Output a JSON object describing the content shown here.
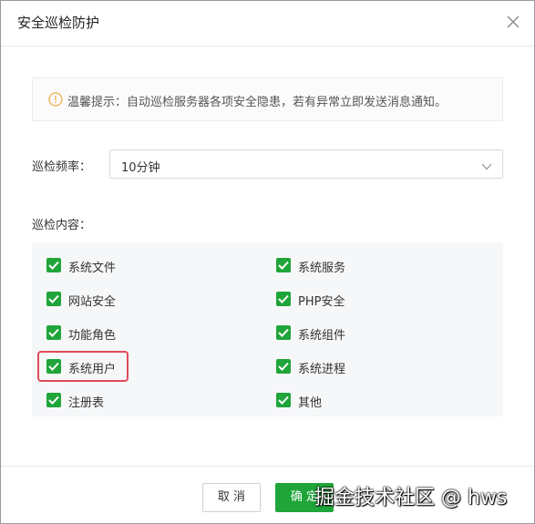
{
  "dialog": {
    "title": "安全巡检防护",
    "close_icon": "close-icon"
  },
  "notice": {
    "icon": "warning-circle-icon",
    "text": "温馨提示：自动巡检服务器各项安全隐患，若有异常立即发送消息通知。"
  },
  "frequency": {
    "label": "巡检频率：",
    "value": "10分钟",
    "arrow_icon": "chevron-down-icon"
  },
  "content": {
    "label": "巡检内容：",
    "items": [
      {
        "label": "系统文件",
        "checked": true
      },
      {
        "label": "系统服务",
        "checked": true
      },
      {
        "label": "网站安全",
        "checked": true
      },
      {
        "label": "PHP安全",
        "checked": true
      },
      {
        "label": "功能角色",
        "checked": true
      },
      {
        "label": "系统组件",
        "checked": true
      },
      {
        "label": "系统用户",
        "checked": true
      },
      {
        "label": "系统进程",
        "checked": true
      },
      {
        "label": "注册表",
        "checked": true
      },
      {
        "label": "其他",
        "checked": true
      }
    ]
  },
  "footer": {
    "cancel_label": "取 消",
    "ok_label": "确 定"
  },
  "watermark": "掘金技术社区 @ hws",
  "colors": {
    "accent": "#20a53a",
    "highlight": "#e04b5a",
    "notice_icon": "#f0ad4e"
  }
}
